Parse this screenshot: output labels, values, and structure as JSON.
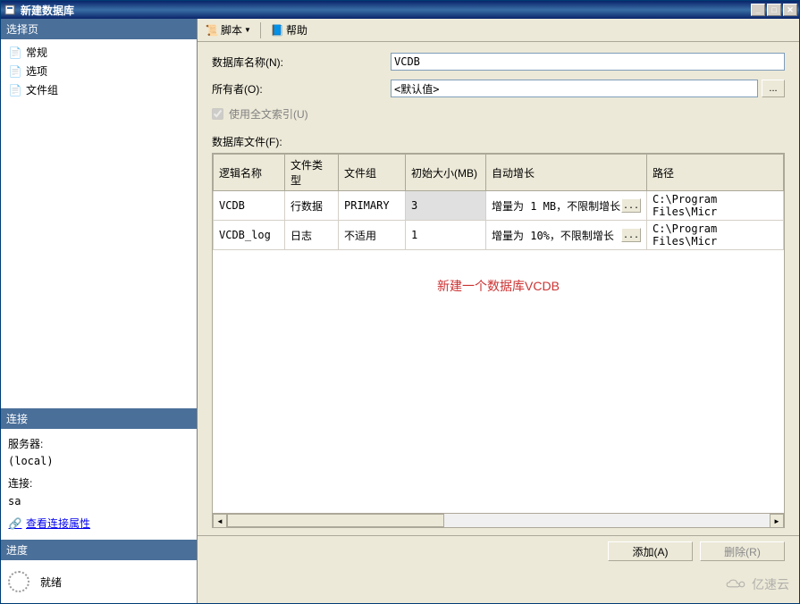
{
  "window": {
    "title": "新建数据库"
  },
  "sidebar": {
    "select_page_header": "选择页",
    "tree_items": [
      {
        "label": "常规",
        "icon": "page-icon"
      },
      {
        "label": "选项",
        "icon": "page-icon"
      },
      {
        "label": "文件组",
        "icon": "page-icon"
      }
    ],
    "connection_header": "连接",
    "connection": {
      "server_label": "服务器:",
      "server_value": "(local)",
      "conn_label": "连接:",
      "conn_value": "sa",
      "view_props": "查看连接属性"
    },
    "progress_header": "进度",
    "progress_status": "就绪"
  },
  "toolbar": {
    "script": "脚本",
    "help": "帮助"
  },
  "form": {
    "db_name_label": "数据库名称(N):",
    "db_name_value": "VCDB",
    "owner_label": "所有者(O):",
    "owner_value": "<默认值>",
    "fulltext_label": "使用全文索引(U)",
    "files_label": "数据库文件(F):"
  },
  "table": {
    "headers": {
      "logical_name": "逻辑名称",
      "file_type": "文件类型",
      "file_group": "文件组",
      "initial_size": "初始大小(MB)",
      "auto_growth": "自动增长",
      "path": "路径"
    },
    "rows": [
      {
        "name": "VCDB",
        "type": "行数据",
        "group": "PRIMARY",
        "size": "3",
        "growth": "增量为 1 MB，不限制增长",
        "path": "C:\\Program Files\\Micr"
      },
      {
        "name": "VCDB_log",
        "type": "日志",
        "group": "不适用",
        "size": "1",
        "growth": "增量为 10%，不限制增长",
        "path": "C:\\Program Files\\Micr"
      }
    ]
  },
  "annotation": "新建一个数据库VCDB",
  "buttons": {
    "add": "添加(A)",
    "delete": "删除(R)"
  },
  "watermark": "亿速云"
}
